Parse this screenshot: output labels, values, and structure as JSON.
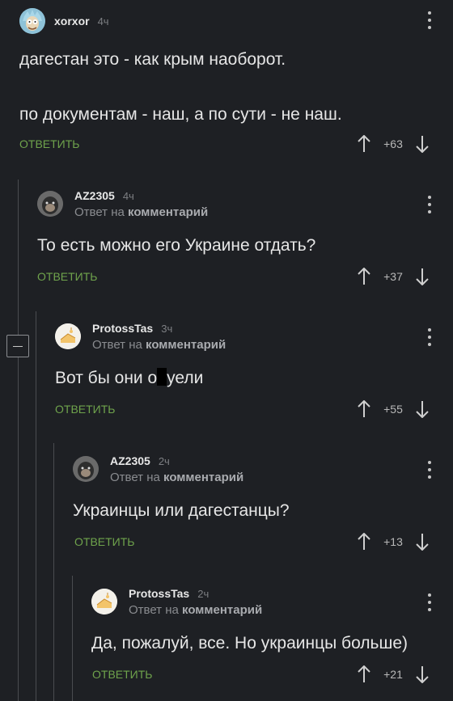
{
  "comments": [
    {
      "username": "xorxor",
      "time": "4ч",
      "reply_to": "",
      "lines": [
        "дагестан это - как крым наоборот.",
        "по документам - наш, а по сути - не наш."
      ],
      "reply_label": "ОТВЕТИТЬ",
      "score": "+63",
      "avatar_icon": "rick-avatar-icon"
    },
    {
      "username": "AZ2305",
      "time": "4ч",
      "reply_to_prefix": "Ответ на",
      "reply_to_target": "комментарий",
      "text": "То есть можно его Украине отдать?",
      "reply_label": "ОТВЕТИТЬ",
      "score": "+37",
      "avatar_icon": "monkey-avatar-icon"
    },
    {
      "username": "ProtossTas",
      "time": "3ч",
      "reply_to_prefix": "Ответ на",
      "reply_to_target": "комментарий",
      "text_before": "Вот бы они о",
      "text_after": "уели",
      "reply_label": "ОТВЕТИТЬ",
      "score": "+55",
      "avatar_icon": "cake-avatar-icon"
    },
    {
      "username": "AZ2305",
      "time": "2ч",
      "reply_to_prefix": "Ответ на",
      "reply_to_target": "комментарий",
      "text": "Украинцы или дагестанцы?",
      "reply_label": "ОТВЕТИТЬ",
      "score": "+13",
      "avatar_icon": "monkey-avatar-icon"
    },
    {
      "username": "ProtossTas",
      "time": "2ч",
      "reply_to_prefix": "Ответ на",
      "reply_to_target": "комментарий",
      "text": "Да, пожалуй, все. Но украинцы больше)",
      "reply_label": "ОТВЕТИТЬ",
      "score": "+21",
      "avatar_icon": "cake-avatar-icon"
    }
  ],
  "colors": {
    "background": "#1e2024",
    "accent_green": "#6fa34c",
    "thread_line": "#4a4c50"
  }
}
